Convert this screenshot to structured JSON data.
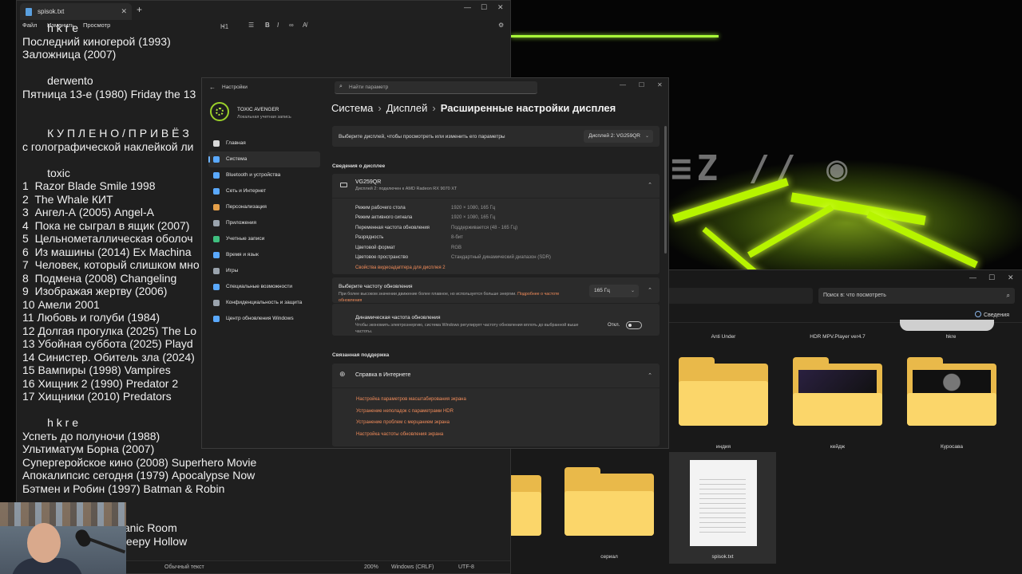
{
  "notepad": {
    "tab_title": "spisok.txt",
    "menu": [
      "Файл",
      "Изменить",
      "Просмотр"
    ],
    "heading_select": "H1",
    "lines": [
      "        h k r e",
      "Последний киногерой (1993)",
      "Заложница (2007)",
      "",
      "        derwento",
      "Пятница 13-е (1980) Friday the 13",
      "",
      "",
      "        К У П Л Е Н О / П Р И В Ё З",
      "с голографической наклейкой ли",
      "",
      "        toxic",
      "1  Razor Blade Smile 1998",
      "2  The Whale КИТ",
      "3  Ангел-А (2005) Angel-A",
      "4  Пока не сыграл в ящик (2007)",
      "5  Цельнометаллическая оболоч",
      "6  Из машины (2014) Ex Machina",
      "7  Человек, который слишком мно",
      "8  Подмена (2008) Changeling",
      "9  Изображая жертву (2006)",
      "10 Амели 2001",
      "11 Любовь и голуби (1984)",
      "12 Долгая прогулка (2025) The Lo",
      "13 Убойная суббота (2025) Playd",
      "14 Синистер. Обитель зла (2024)",
      "15 Вампиры (1998) Vampires",
      "16 Хищник 2 (1990) Predator 2",
      "17 Хищники (2010) Predators",
      "",
      "        h k r e",
      "Успеть до полуночи (1988)",
      "Ультиматум Борна (2007)",
      "Супергеройское кино (2008) Superhero Movie",
      "Апокалипсис сегодня (1979) Apocalypse Now",
      "Бэтмен и Робин (1997) Batman & Robin",
      "",
      "",
      "                        02) Panic Room",
      "                        99) Sleepy Hollow"
    ],
    "status": {
      "format": "Обычный текст",
      "zoom": "200%",
      "eol": "Windows (CRLF)",
      "encoding": "UTF-8"
    }
  },
  "settings": {
    "app_title": "Настройки",
    "search_placeholder": "Найти параметр",
    "user": {
      "name": "TOXIC AVENGER",
      "account": "Локальная учетная запись"
    },
    "nav": [
      {
        "label": "Главная",
        "color": "#d9d9d9"
      },
      {
        "label": "Система",
        "color": "#5aa9ff",
        "active": true
      },
      {
        "label": "Bluetooth и устройства",
        "color": "#5aa9ff"
      },
      {
        "label": "Сеть и Интернет",
        "color": "#5aa9ff"
      },
      {
        "label": "Персонализация",
        "color": "#e6a04a"
      },
      {
        "label": "Приложения",
        "color": "#9aa3ad"
      },
      {
        "label": "Учетные записи",
        "color": "#3fbf7f"
      },
      {
        "label": "Время и язык",
        "color": "#5aa9ff"
      },
      {
        "label": "Игры",
        "color": "#9aa3ad"
      },
      {
        "label": "Специальные возможности",
        "color": "#5aa9ff"
      },
      {
        "label": "Конфиденциальность и защита",
        "color": "#9aa3ad"
      },
      {
        "label": "Центр обновления Windows",
        "color": "#5aa9ff"
      }
    ],
    "breadcrumb": {
      "level1": "Система",
      "level2": "Дисплей",
      "current": "Расширенные настройки дисплея"
    },
    "select_display": {
      "label": "Выберите дисплей, чтобы просмотреть или изменить его параметры",
      "value": "Дисплей 2: VG259QR"
    },
    "display_info_title": "Сведения о дисплее",
    "monitor": {
      "name": "VG259QR",
      "subtitle": "Дисплей 2: подключен к AMD Radeon RX 9070 XT"
    },
    "properties": [
      {
        "label": "Режим рабочего стола",
        "value": "1920 × 1080, 165 Гц"
      },
      {
        "label": "Режим активного сигнала",
        "value": "1920 × 1080, 165 Гц"
      },
      {
        "label": "Переменная частота обновления",
        "value": "Поддерживается (48 - 165 Гц)"
      },
      {
        "label": "Разрядность",
        "value": "8-бит"
      },
      {
        "label": "Цветовой формат",
        "value": "RGB"
      },
      {
        "label": "Цветовое пространство",
        "value": "Стандартный динамический диапазон (SDR)"
      }
    ],
    "adapter_link": "Свойства видеоадаптера для дисплея 2",
    "refresh": {
      "title": "Выберите частоту обновления",
      "desc": "При более высоком значении движение более плавное, но используется больше энергии.",
      "desc_link": "Подробнее о частоте обновления",
      "value": "165 Гц"
    },
    "dynamic": {
      "title": "Динамическая частота обновления",
      "desc": "Чтобы экономить электроэнергию, система Windows регулирует частоту обновления вплоть до выбранной выше частоты.",
      "state": "Откл."
    },
    "support_title": "Связанная поддержка",
    "help": {
      "title": "Справка в Интернете",
      "links": [
        "Настройка параметров масштабирования экрана",
        "Устранение неполадок с параметрами HDR",
        "Устранение проблем с мерцанием экрана",
        "Настройка частоты обновления экрана"
      ]
    }
  },
  "explorer": {
    "search_placeholder": "Поиск в: что посмотреть",
    "details_label": "Сведения",
    "top_items": [
      "Anti Under",
      "HDR MPV.Player ver4.7",
      "hkre"
    ],
    "folders": [
      {
        "label": "индия"
      },
      {
        "label": "кейдж"
      },
      {
        "label": "Куросава"
      },
      {
        "label": "сериал"
      }
    ],
    "file": {
      "label": "spisok.txt"
    }
  },
  "colors": {
    "accent": "#5aa9ff",
    "link": "#f28c5a",
    "wallpaper_neon": "#b7f400"
  }
}
